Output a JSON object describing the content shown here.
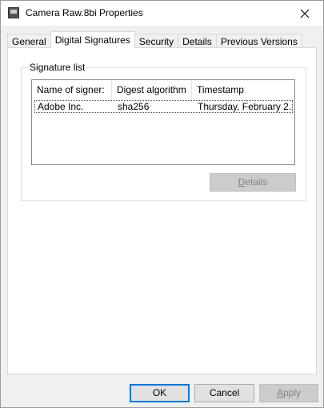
{
  "window": {
    "title": "Camera Raw.8bi Properties",
    "app_icon": "plugin-file-icon",
    "close_icon": "close-icon"
  },
  "tabs": [
    {
      "label": "General",
      "active": false
    },
    {
      "label": "Digital Signatures",
      "active": true
    },
    {
      "label": "Security",
      "active": false
    },
    {
      "label": "Details",
      "active": false
    },
    {
      "label": "Previous Versions",
      "active": false
    }
  ],
  "signatures": {
    "group_label": "Signature list",
    "columns": [
      "Name of signer:",
      "Digest algorithm",
      "Timestamp"
    ],
    "rows": [
      {
        "name": "Adobe Inc.",
        "digest": "sha256",
        "timestamp": "Thursday, February 2..."
      }
    ],
    "details_button": {
      "pre": "",
      "accel": "D",
      "post": "etails",
      "enabled": false
    }
  },
  "footer": {
    "ok": "OK",
    "cancel": "Cancel",
    "apply_accel": "A",
    "apply_rest": "pply",
    "apply_enabled": false
  },
  "colors": {
    "accent": "#0078d7",
    "dialog_bg": "#f0f0f0",
    "panel_bg": "#ffffff"
  }
}
